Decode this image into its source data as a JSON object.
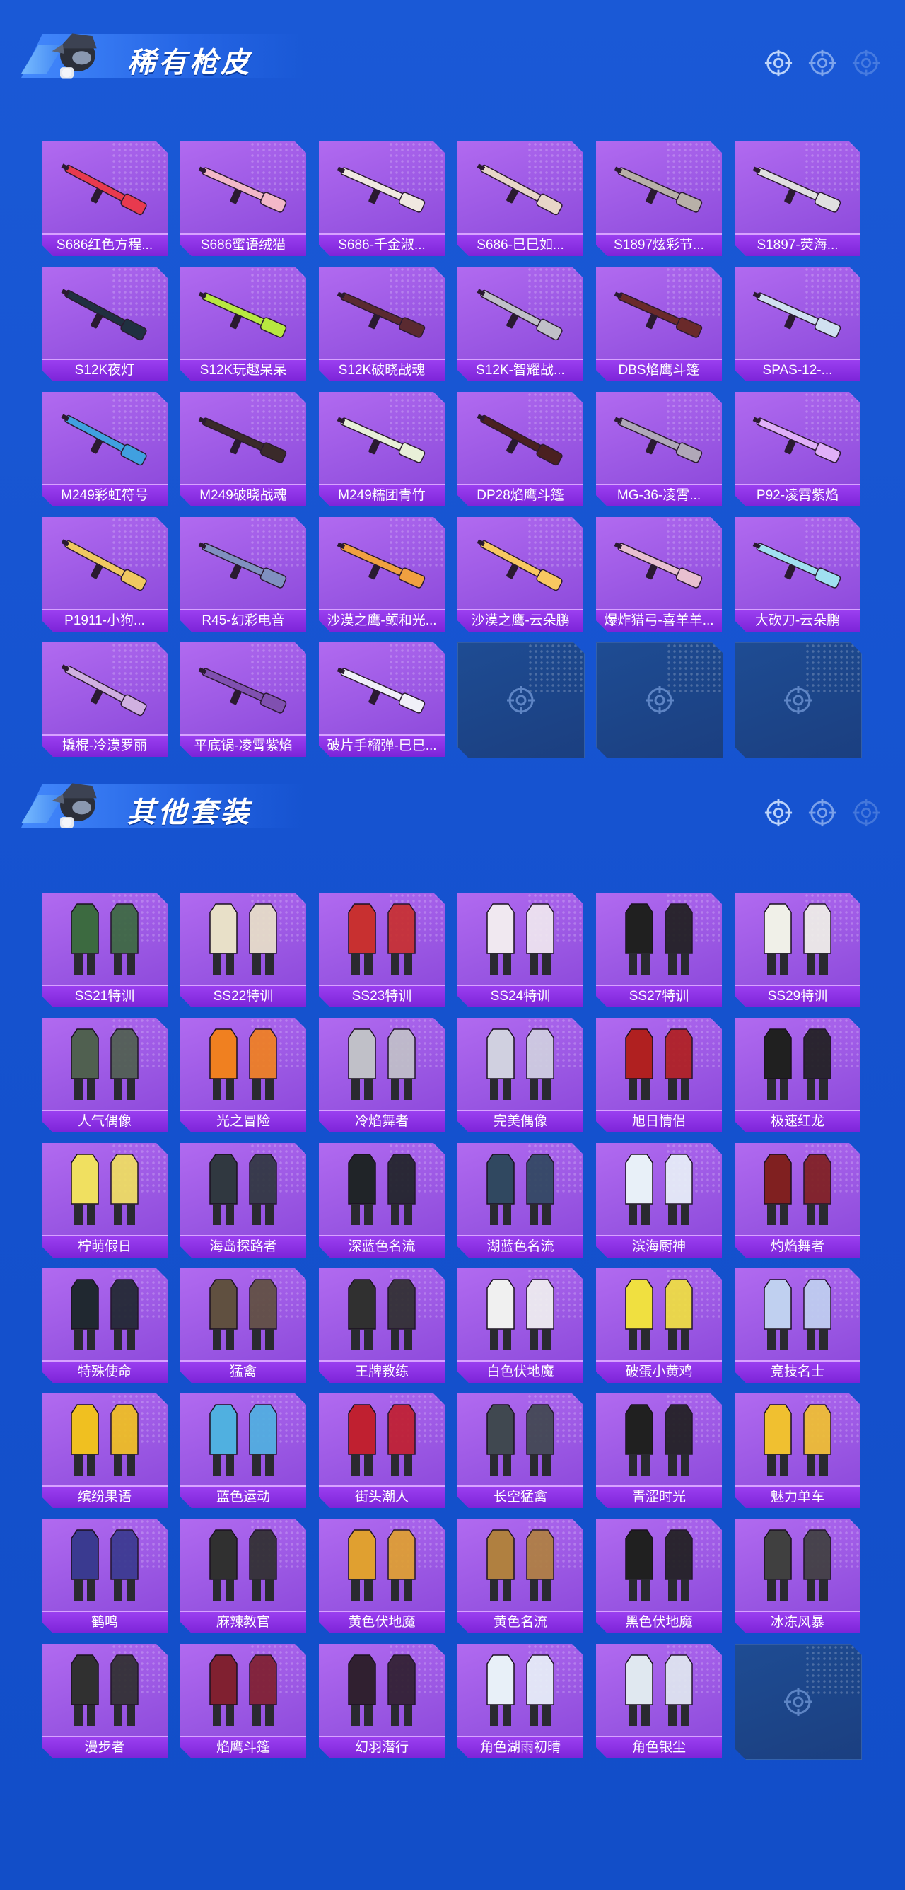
{
  "sections": [
    {
      "title": "稀有枪皮",
      "kind": "gun",
      "items": [
        "S686红色方程...",
        "S686蜜语绒猫",
        "S686-千金淑...",
        "S686-巳巳如...",
        "S1897炫彩节...",
        "S1897-荧海...",
        "S12K夜灯",
        "S12K玩趣呆呆",
        "S12K破晓战魂",
        "S12K-智耀战...",
        "DBS焰鹰斗篷",
        "SPAS-12-...",
        "M249彩虹符号",
        "M249破晓战魂",
        "M249糯团青竹",
        "DP28焰鹰斗篷",
        "MG-36-凌霄...",
        "P92-凌霄紫焰",
        "P1911-小狗...",
        "R45-幻彩电音",
        "沙漠之鹰-颤和光...",
        "沙漠之鹰-云朵鹏",
        "爆炸猎弓-喜羊羊...",
        "大砍刀-云朵鹏",
        "撬棍-冷漠罗丽",
        "平底锅-凌霄紫焰",
        "破片手榴弹-巳巳..."
      ],
      "empty_slots": 3
    },
    {
      "title": "其他套装",
      "kind": "outfit",
      "items": [
        "SS21特训",
        "SS22特训",
        "SS23特训",
        "SS24特训",
        "SS27特训",
        "SS29特训",
        "人气偶像",
        "光之冒险",
        "冷焰舞者",
        "完美偶像",
        "旭日情侣",
        "极速红龙",
        "柠萌假日",
        "海岛探路者",
        "深蓝色名流",
        "湖蓝色名流",
        "滨海厨神",
        "灼焰舞者",
        "特殊使命",
        "猛禽",
        "王牌教练",
        "白色伏地魔",
        "破蛋小黄鸡",
        "竞技名士",
        "缤纷果语",
        "蓝色运动",
        "街头潮人",
        "长空猛禽",
        "青涩时光",
        "魅力单车",
        "鹤鸣",
        "麻辣教官",
        "黄色伏地魔",
        "黄色名流",
        "黑色伏地魔",
        "冰冻风暴",
        "漫步者",
        "焰鹰斗篷",
        "幻羽潜行",
        "角色湖雨初晴",
        "角色银尘"
      ],
      "empty_slots": 1
    }
  ],
  "colors": {
    "background": "#1552cf",
    "card_purple": "#a062ea",
    "label_purple": "#8a30e0",
    "empty_slot": "#1d4688"
  },
  "icons": {
    "header_mascot": "soldier-mascot-icon",
    "header_deco": "crosshair-icon",
    "empty_slot": "crosshair-icon"
  }
}
